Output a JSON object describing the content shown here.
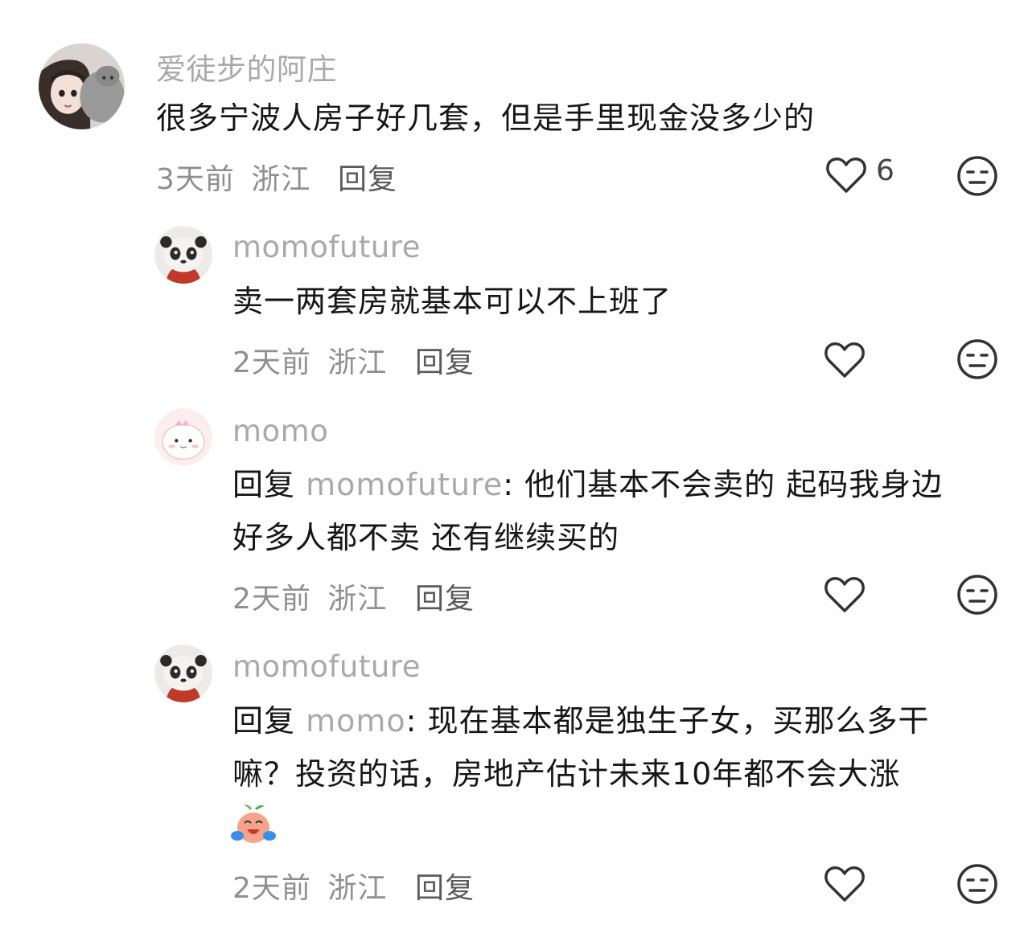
{
  "comments": [
    {
      "username": "爱徒步的阿庄",
      "text": "很多宁波人房子好几套，但是手里现金没多少的",
      "time": "3天前",
      "location": "浙江",
      "reply_label": "回复",
      "likes": "6"
    },
    {
      "username": "momofuture",
      "text": "卖一两套房就基本可以不上班了",
      "time": "2天前",
      "location": "浙江",
      "reply_label": "回复"
    },
    {
      "username": "momo",
      "reply_prefix": "回复",
      "reply_target": "momofuture",
      "line1": ": 他们基本不会卖的 起码我身边",
      "line2": "好多人都不卖 还有继续买的",
      "time": "2天前",
      "location": "浙江",
      "reply_label": "回复"
    },
    {
      "username": "momofuture",
      "reply_prefix": "回复",
      "reply_target": "momo",
      "line1": ": 现在基本都是独生子女，买那么多干",
      "line2": "嘛？投资的话，房地产估计未来10年都不会大涨",
      "emoji": "crying-laughing-peach-emoji",
      "time": "2天前",
      "location": "浙江",
      "reply_label": "回复"
    }
  ],
  "icons": {
    "like": "heart-outline-icon",
    "dislike": "meh-face-icon"
  }
}
